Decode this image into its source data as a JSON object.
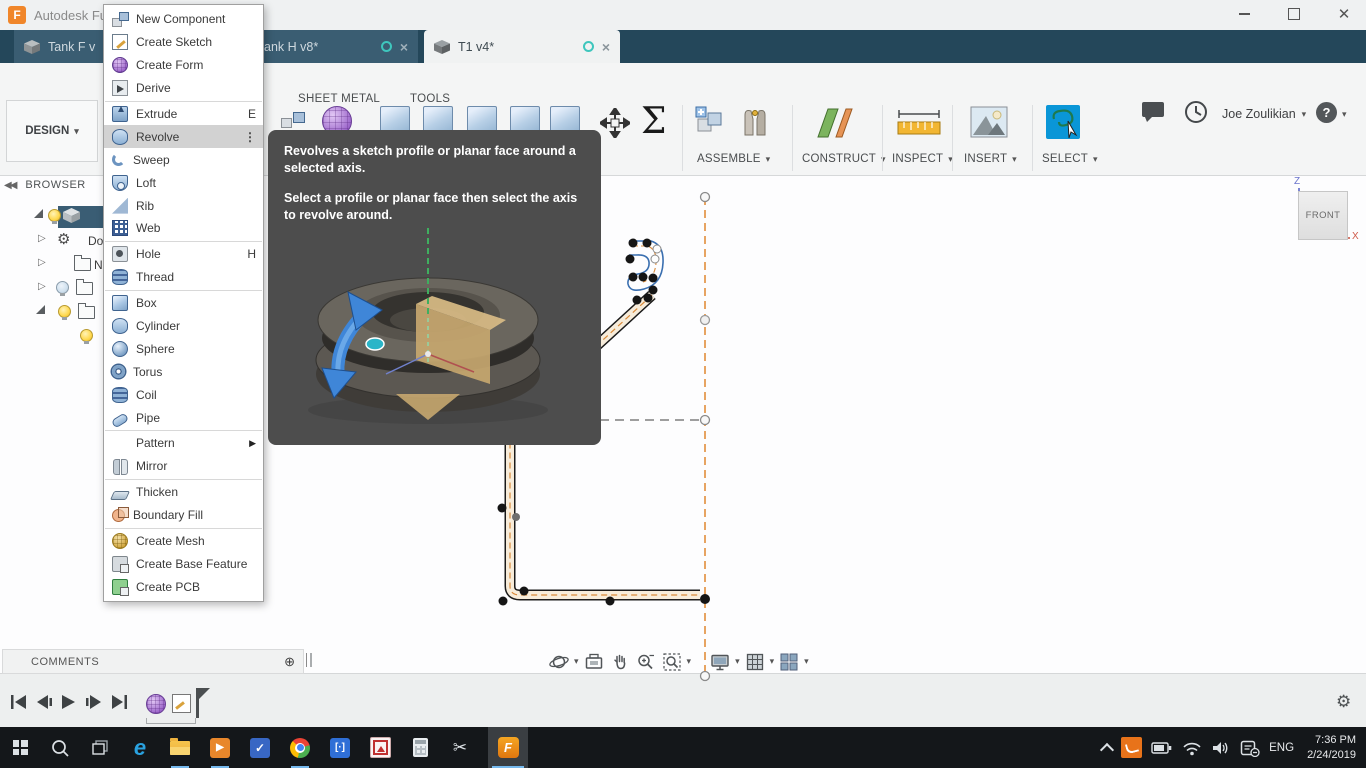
{
  "window": {
    "app_title": "Autodesk Fusio"
  },
  "doc_tabs": {
    "tabs": [
      {
        "title": "Tank F v"
      },
      {
        "title": "ank H v8*"
      },
      {
        "title": "T1 v4*"
      }
    ],
    "new_tab": "+"
  },
  "workspace_selector": {
    "label": "DESIGN",
    "caret": "▾"
  },
  "ribbon": {
    "tabs": [
      "SHEET METAL",
      "TOOLS"
    ],
    "sigma": "Σ",
    "groups": [
      "ASSEMBLE",
      "CONSTRUCT",
      "INSPECT",
      "INSERT",
      "SELECT"
    ],
    "caret": "▾"
  },
  "account": {
    "user": "Joe Zoulikian",
    "caret": "▾",
    "help": "?"
  },
  "browser_panel": {
    "header": "BROWSER",
    "collapse_glyph": "◀◀",
    "rows": [
      {
        "label": ""
      },
      {
        "label": "Do"
      },
      {
        "label": "Na"
      },
      {
        "label": ""
      },
      {
        "label": ""
      },
      {
        "label": ""
      }
    ]
  },
  "create_menu": {
    "items": [
      {
        "label": "New Component",
        "shortcut": "",
        "icon": "new-component"
      },
      {
        "label": "Create Sketch",
        "shortcut": "",
        "icon": "create-sketch"
      },
      {
        "label": "Create Form",
        "shortcut": "",
        "icon": "create-form"
      },
      {
        "label": "Derive",
        "shortcut": "",
        "icon": "derive"
      },
      {
        "label": "Extrude",
        "shortcut": "E",
        "icon": "extrude"
      },
      {
        "label": "Revolve",
        "shortcut": "",
        "icon": "revolve",
        "more": "⋮",
        "highlighted": true
      },
      {
        "label": "Sweep",
        "shortcut": "",
        "icon": "sweep"
      },
      {
        "label": "Loft",
        "shortcut": "",
        "icon": "loft"
      },
      {
        "label": "Rib",
        "shortcut": "",
        "icon": "rib"
      },
      {
        "label": "Web",
        "shortcut": "",
        "icon": "web"
      },
      {
        "label": "Hole",
        "shortcut": "H",
        "icon": "hole"
      },
      {
        "label": "Thread",
        "shortcut": "",
        "icon": "thread"
      },
      {
        "label": "Box",
        "shortcut": "",
        "icon": "box"
      },
      {
        "label": "Cylinder",
        "shortcut": "",
        "icon": "cylinder"
      },
      {
        "label": "Sphere",
        "shortcut": "",
        "icon": "sphere"
      },
      {
        "label": "Torus",
        "shortcut": "",
        "icon": "torus"
      },
      {
        "label": "Coil",
        "shortcut": "",
        "icon": "coil"
      },
      {
        "label": "Pipe",
        "shortcut": "",
        "icon": "pipe"
      },
      {
        "label": "Pattern",
        "shortcut": "",
        "icon": "",
        "submenu_glyph": "▶"
      },
      {
        "label": "Mirror",
        "shortcut": "",
        "icon": "mirror"
      },
      {
        "label": "Thicken",
        "shortcut": "",
        "icon": "thicken"
      },
      {
        "label": "Boundary Fill",
        "shortcut": "",
        "icon": "boundary-fill"
      },
      {
        "label": "Create Mesh",
        "shortcut": "",
        "icon": "create-mesh"
      },
      {
        "label": "Create Base Feature",
        "shortcut": "",
        "icon": "create-base-feature"
      },
      {
        "label": "Create PCB",
        "shortcut": "",
        "icon": "create-pcb"
      }
    ]
  },
  "tooltip": {
    "para1": "Revolves a sketch profile or planar face around a selected axis.",
    "para2": "Select a profile or planar face then select the axis to revolve around."
  },
  "viewcube": {
    "face": "FRONT",
    "z": "Z",
    "x": "X"
  },
  "comments_bar": {
    "label": "COMMENTS",
    "add": "⊕"
  },
  "navbar": {
    "icons": [
      "orbit",
      "look-at",
      "pan",
      "zoom",
      "fit",
      "display-settings",
      "grid",
      "viewports"
    ]
  },
  "timeline": {
    "playback": [
      "go-to-start",
      "step-back",
      "play",
      "step-forward",
      "go-to-end"
    ],
    "gear": "⚙"
  },
  "taskbar": {
    "apps": [
      "start",
      "search",
      "task-view",
      "edge",
      "file-explorer",
      "movies-tv",
      "todo",
      "chrome",
      "dev-app",
      "irfanview",
      "calculator",
      "snipping-tool",
      "fusion-360"
    ],
    "language": "ENG",
    "time": "7:36 PM",
    "date": "2/24/2019",
    "fusion_glyph": "F",
    "edge_glyph": "e",
    "todo_glyph": "✓",
    "play_glyph": "▶",
    "dev_glyph": "[·]"
  },
  "colors": {
    "accent_blue": "#0a96d7",
    "fusion_orange": "#f0862a",
    "centerline_orange": "#e0862e",
    "tab_dark": "#24475a"
  }
}
